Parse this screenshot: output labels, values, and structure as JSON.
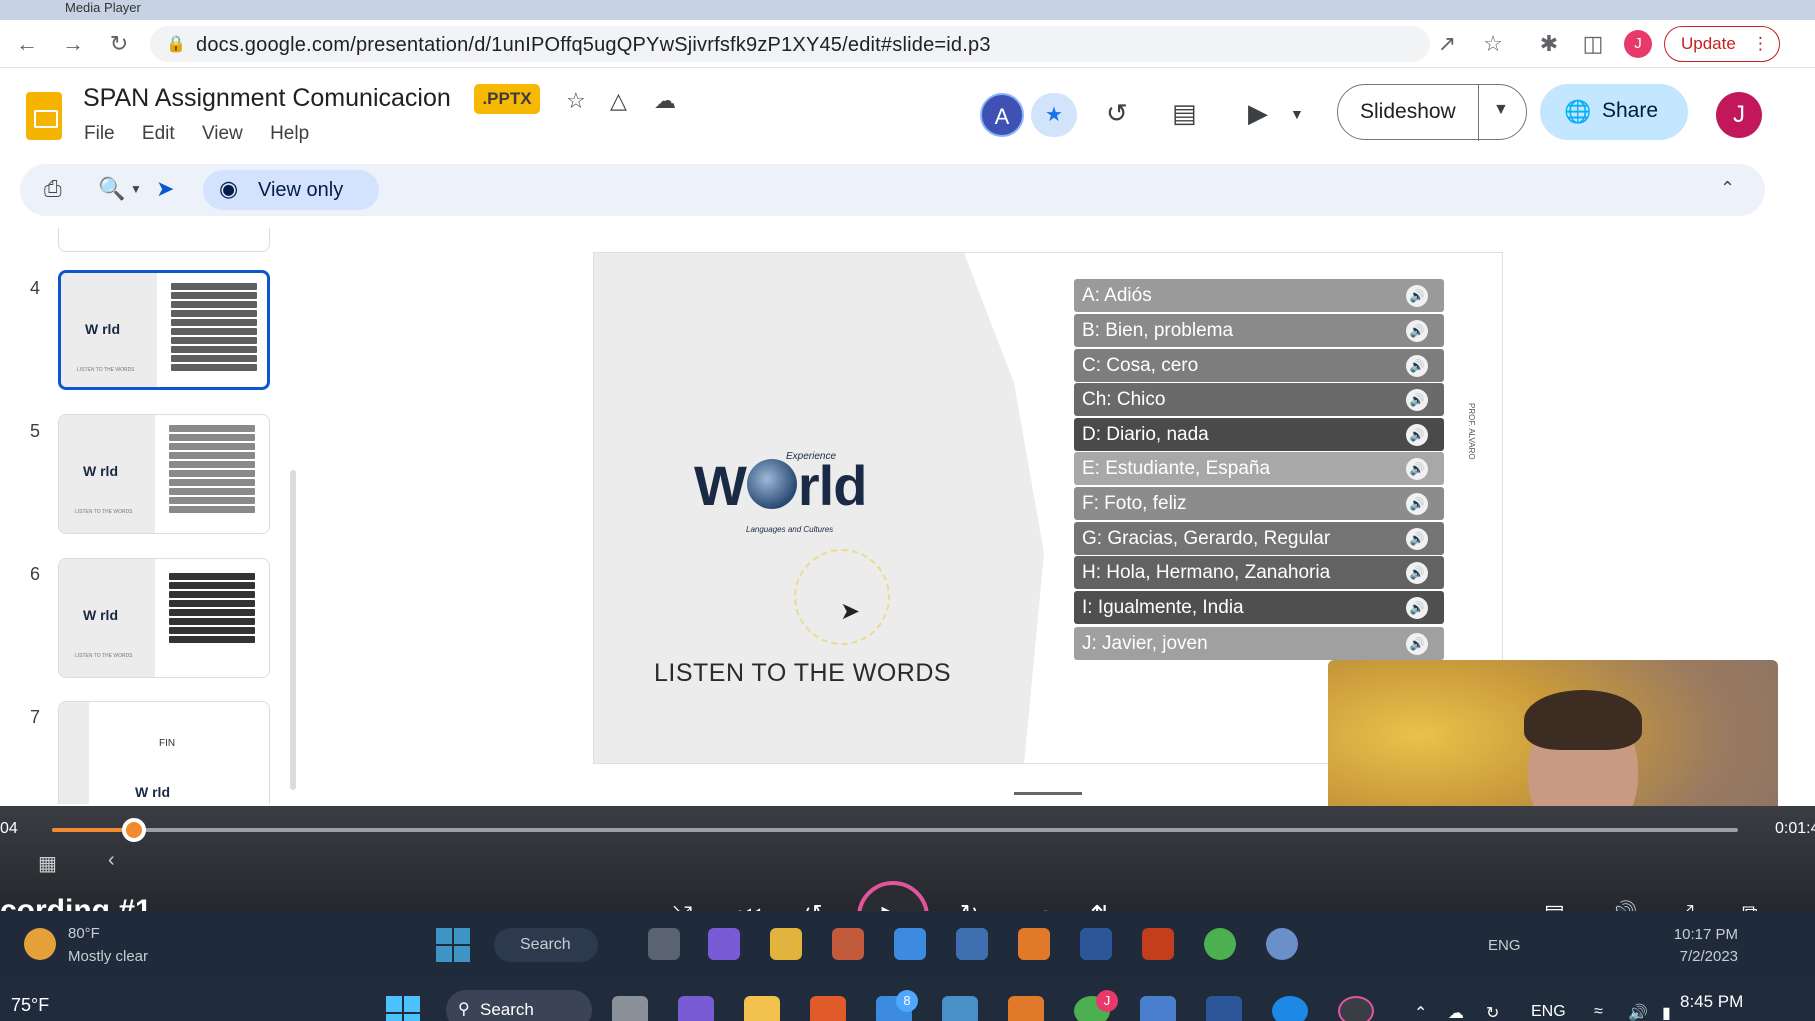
{
  "browser": {
    "tab_label": "Media Player",
    "url": "docs.google.com/presentation/d/1unIPOffq5ugQPYwSjivrfsfk9zP1XY45/edit#slide=id.p3",
    "profile_initial": "J",
    "update_label": "Update"
  },
  "slides_app": {
    "title": "SPAN  Assignment Comunicacion",
    "badge": ".PPTX",
    "menu": [
      "File",
      "Edit",
      "View",
      "Help"
    ],
    "collaborator_initial": "A",
    "slideshow_label": "Slideshow",
    "share_label": "Share",
    "user_initial": "J",
    "view_only_label": "View only"
  },
  "filmstrip": {
    "slides": [
      {
        "number": "4",
        "active": true
      },
      {
        "number": "5",
        "active": false
      },
      {
        "number": "6",
        "active": false
      },
      {
        "number": "7",
        "active": false,
        "text": "FIN"
      }
    ],
    "thumb_logo": "W rld",
    "thumb_caption": "LISTEN TO THE WORDS"
  },
  "slide": {
    "logo_top": "Experience",
    "logo_w": "W",
    "logo_rld": "rld",
    "logo_bottom": "Languages and Cultures",
    "heading": "LISTEN TO THE WORDS",
    "side_text": "PROF. ALVARO",
    "words": [
      {
        "label": "A: Adiós",
        "color": "#9a9a9a"
      },
      {
        "label": "B: Bien, problema",
        "color": "#8a8a8a"
      },
      {
        "label": "C: Cosa, cero",
        "color": "#7d7d7d"
      },
      {
        "label": "Ch: Chico",
        "color": "#6a6a6a"
      },
      {
        "label": "D: Diario, nada",
        "color": "#4a4a4a"
      },
      {
        "label": "E: Estudiante, España",
        "color": "#a8a8a8"
      },
      {
        "label": "F: Foto, feliz",
        "color": "#8c8c8c"
      },
      {
        "label": "G: Gracias, Gerardo, Regular",
        "color": "#747474"
      },
      {
        "label": "H: Hola, Hermano, Zanahoria",
        "color": "#626262"
      },
      {
        "label": "I: Igualmente, India",
        "color": "#4f4f4f"
      },
      {
        "label": "J: Javier, joven",
        "color": "#a0a0a0"
      }
    ]
  },
  "player": {
    "time_elapsed": "04",
    "time_total": "0:01:4",
    "recording_title": "cording #1",
    "progress_fraction": 0.05
  },
  "inner_taskbar": {
    "temp": "80°F",
    "weather": "Mostly clear",
    "search_label": "Search",
    "lang": "ENG",
    "time": "10:17 PM",
    "date": "7/2/2023"
  },
  "outer_taskbar": {
    "temp": "75°F",
    "search_label": "Search",
    "mail_badge": "8",
    "chrome_badge": "J",
    "lang": "ENG",
    "time": "8:45 PM"
  }
}
